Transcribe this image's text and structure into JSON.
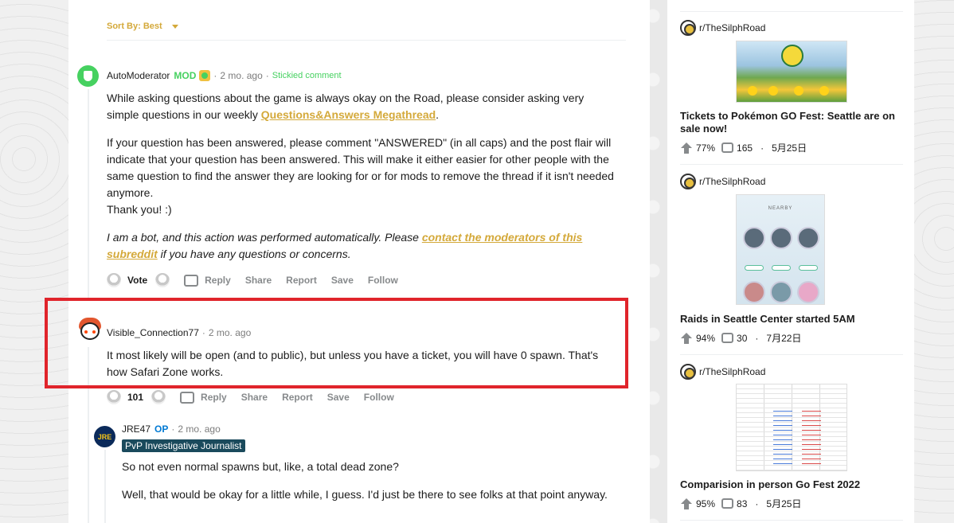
{
  "sort": {
    "label": "Sort By: Best"
  },
  "comments": [
    {
      "author": "AutoModerator",
      "mod_badge": "MOD",
      "time": "2 mo. ago",
      "sticky": "Stickied comment",
      "p1_before": "While asking questions about the game is always okay on the Road, please consider asking very simple questions in our weekly ",
      "p1_link": "Questions&Answers Megathread",
      "p1_after": ".",
      "p2": "If your question has been answered, please comment \"ANSWERED\" (in all caps) and the post flair will indicate that your question has been answered. This will make it either easier for other people with the same question to find the answer they are looking for or for mods to remove the thread if it isn't needed anymore.",
      "p2b": "Thank you! :)",
      "p3_before": "I am a bot, and this action was performed automatically. Please ",
      "p3_link": "contact the moderators of this subreddit",
      "p3_after": " if you have any questions or concerns.",
      "vote": "Vote"
    },
    {
      "author": "Visible_Connection77",
      "time": "2 mo. ago",
      "body": "It most likely will be open (and to public), but unless you have a ticket, you will have 0 spawn. That's how Safari Zone works.",
      "vote": "101"
    },
    {
      "author": "JRE47",
      "op_badge": "OP",
      "time": "2 mo. ago",
      "flair": "PvP Investigative Journalist",
      "avatar_text": "JRE",
      "p1": "So not even normal spawns but, like, a total dead zone?",
      "p2": "Well, that would be okay for a little while, I guess. I'd just be there to see folks at that point anyway."
    }
  ],
  "actions": {
    "reply": "Reply",
    "share": "Share",
    "report": "Report",
    "save": "Save",
    "follow": "Follow"
  },
  "separator": "·",
  "sidebar": {
    "cards": [
      {
        "subreddit": "r/TheSilphRoad",
        "title": "Tickets to Pokémon GO Fest: Seattle are on sale now!",
        "upvote": "77%",
        "comments": "165",
        "date": "5月25日"
      },
      {
        "subreddit": "r/TheSilphRoad",
        "title": "Raids in Seattle Center started 5AM",
        "upvote": "94%",
        "comments": "30",
        "date": "7月22日",
        "thumb_title": "NEARBY"
      },
      {
        "subreddit": "r/TheSilphRoad",
        "title": "Comparision in person Go Fest 2022",
        "upvote": "95%",
        "comments": "83",
        "date": "5月25日"
      }
    ]
  }
}
